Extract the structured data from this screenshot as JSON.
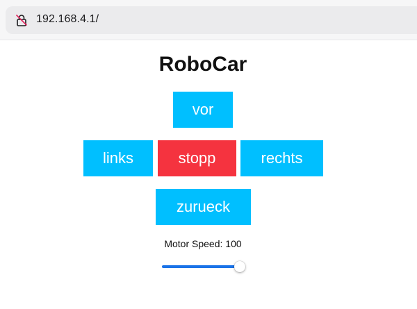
{
  "browser": {
    "url": "192.168.4.1/",
    "lock_icon": "insecure-lock-icon"
  },
  "page": {
    "title": "RoboCar",
    "buttons": {
      "forward": "vor",
      "left": "links",
      "stop": "stopp",
      "right": "rechts",
      "back": "zurueck"
    },
    "speed_label": "Motor Speed: 100",
    "speed_value": 100,
    "colors": {
      "button": "#00bfff",
      "stop": "#f5333f",
      "slider": "#1a73e8"
    }
  }
}
